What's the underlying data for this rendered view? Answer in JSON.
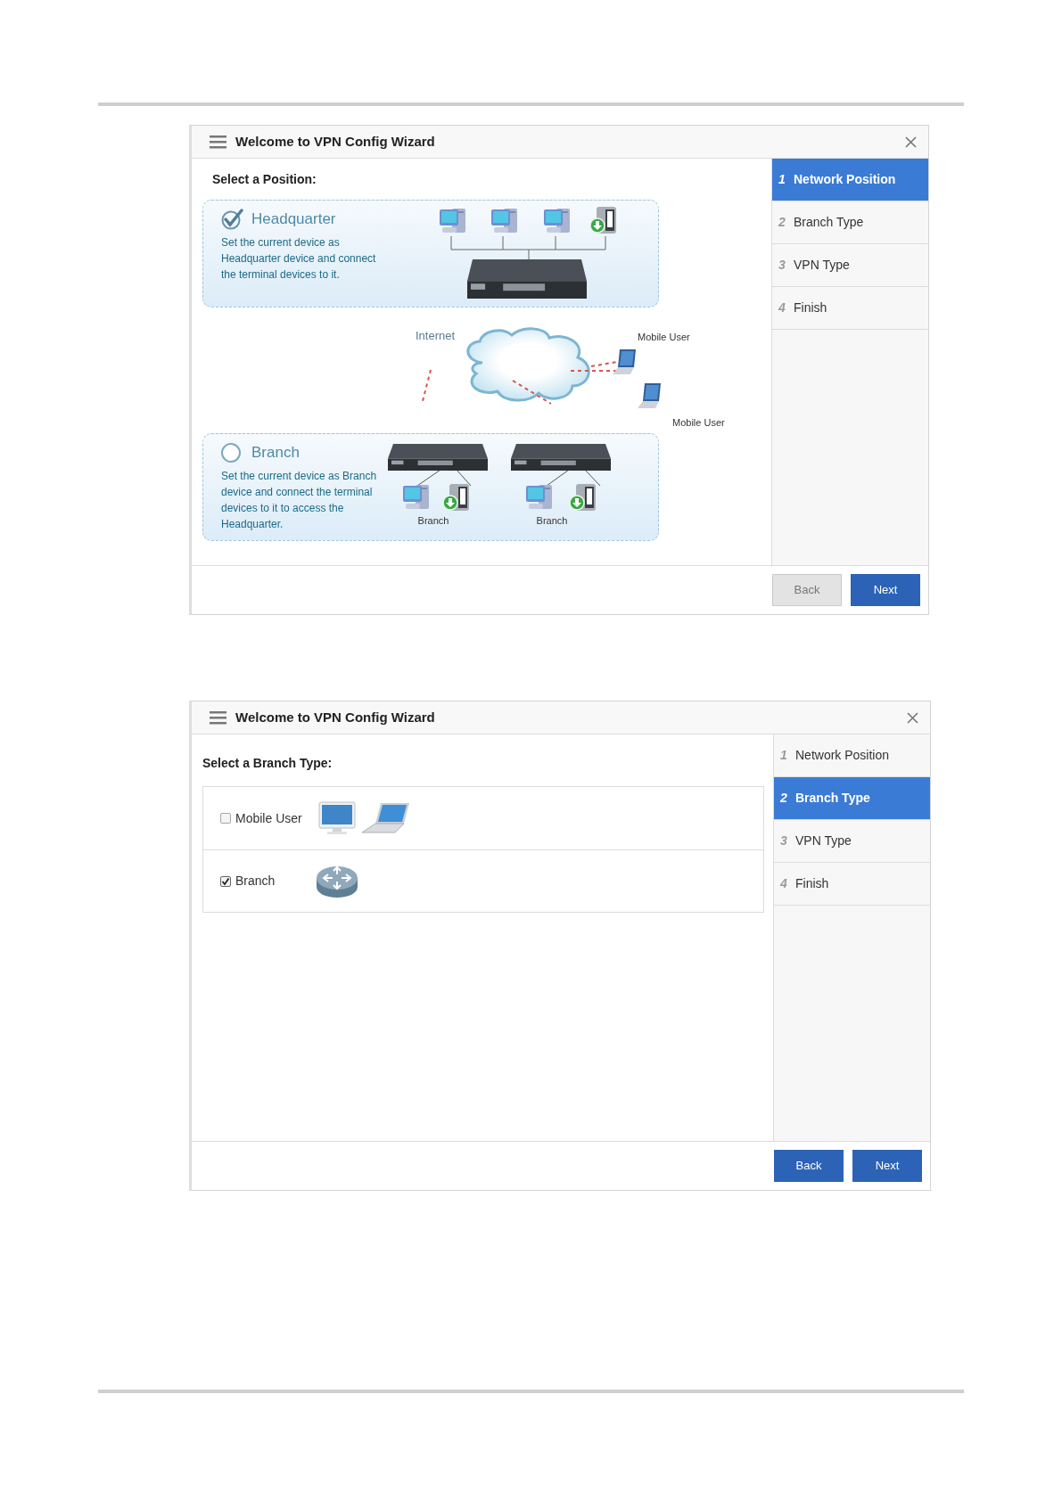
{
  "wizards": [
    {
      "kind": "position",
      "title": "Welcome to VPN Config Wizard",
      "heading": "Select a Position:",
      "options": [
        {
          "kind": "headquarter",
          "label": "Headquarter",
          "description": "Set the current device as Headquarter device and connect the terminal devices to it.",
          "selected": true
        },
        {
          "kind": "branch",
          "label": "Branch",
          "description": "Set the current device as Branch device and connect the terminal devices to it to access the Headquarter.",
          "selected": false,
          "site_labels": [
            "Branch",
            "Branch"
          ]
        }
      ],
      "diagram": {
        "cloud_label": "Internet",
        "mobile_labels": [
          "Mobile User",
          "Mobile User"
        ]
      },
      "steps": [
        {
          "number": "1",
          "label": "Network Position",
          "selected": true
        },
        {
          "number": "2",
          "label": "Branch Type",
          "selected": false
        },
        {
          "number": "3",
          "label": "VPN Type",
          "selected": false
        },
        {
          "number": "4",
          "label": "Finish",
          "selected": false
        }
      ],
      "buttons": [
        {
          "label": "Back",
          "disabled": true
        },
        {
          "label": "Next",
          "disabled": false
        }
      ]
    },
    {
      "kind": "branch_type",
      "title": "Welcome to VPN Config Wizard",
      "heading": "Select a Branch Type:",
      "options": [
        {
          "kind": "terminal",
          "label": "Mobile User",
          "checked": false
        },
        {
          "kind": "router",
          "label": "Branch",
          "checked": true
        }
      ],
      "steps": [
        {
          "number": "1",
          "label": "Network Position",
          "selected": false
        },
        {
          "number": "2",
          "label": "Branch Type",
          "selected": true
        },
        {
          "number": "3",
          "label": "VPN Type",
          "selected": false
        },
        {
          "number": "4",
          "label": "Finish",
          "selected": false
        }
      ],
      "buttons": [
        {
          "label": "Back",
          "disabled": false
        },
        {
          "label": "Next",
          "disabled": false
        }
      ]
    }
  ]
}
